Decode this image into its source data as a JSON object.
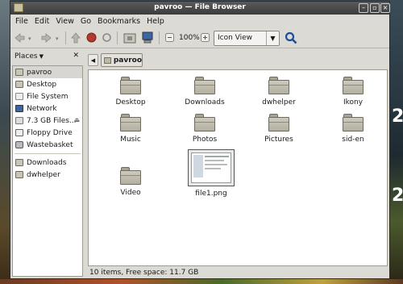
{
  "window": {
    "title": "pavroo — File Browser"
  },
  "menubar": {
    "items": [
      "File",
      "Edit",
      "View",
      "Go",
      "Bookmarks",
      "Help"
    ]
  },
  "toolbar": {
    "zoom": "100%",
    "view_mode": "Icon View"
  },
  "sidebar": {
    "header": "Places",
    "places": [
      {
        "label": "pavroo",
        "icon": "home-folder-icon"
      },
      {
        "label": "Desktop",
        "icon": "desktop-icon"
      },
      {
        "label": "File System",
        "icon": "filesystem-icon"
      },
      {
        "label": "Network",
        "icon": "network-icon"
      },
      {
        "label": "7.3 GB Files...",
        "icon": "drive-icon"
      },
      {
        "label": "Floppy Drive",
        "icon": "floppy-icon"
      },
      {
        "label": "Wastebasket",
        "icon": "trash-icon"
      }
    ],
    "bookmarks": [
      {
        "label": "Downloads",
        "icon": "folder-icon"
      },
      {
        "label": "dwhelper",
        "icon": "folder-icon"
      }
    ]
  },
  "pathbar": {
    "current": "pavroo"
  },
  "files": [
    {
      "name": "Desktop",
      "type": "folder"
    },
    {
      "name": "Downloads",
      "type": "folder"
    },
    {
      "name": "dwhelper",
      "type": "folder"
    },
    {
      "name": "Ikony",
      "type": "folder"
    },
    {
      "name": "Music",
      "type": "folder"
    },
    {
      "name": "Photos",
      "type": "folder"
    },
    {
      "name": "Pictures",
      "type": "folder"
    },
    {
      "name": "sid-en",
      "type": "folder"
    },
    {
      "name": "Video",
      "type": "folder"
    },
    {
      "name": "file1.png",
      "type": "image"
    }
  ],
  "status": {
    "text": "10 items, Free space: 11.7 GB"
  },
  "desktop": {
    "right_digits": [
      "2",
      "2"
    ]
  }
}
